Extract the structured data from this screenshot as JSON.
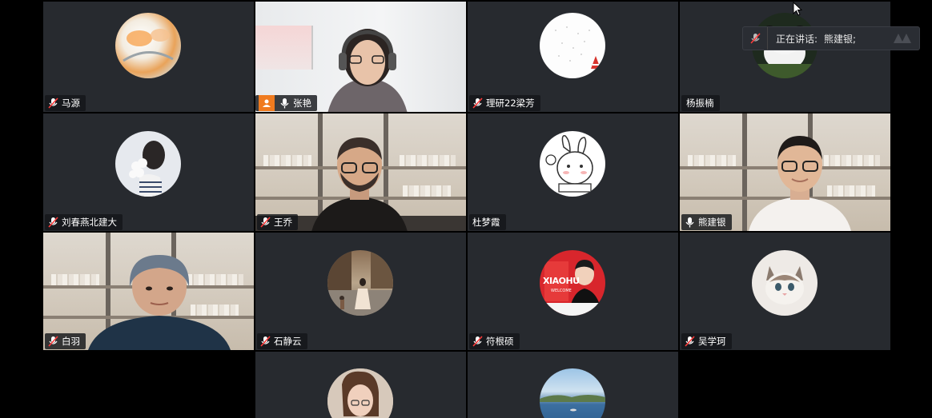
{
  "speaking_popup": {
    "label": "正在讲话:",
    "name": "熊建银;"
  },
  "participants": [
    {
      "name": "马源",
      "mic": "muted",
      "view": "avatar"
    },
    {
      "name": "张艳",
      "mic": "on",
      "view": "video",
      "host_badge": true
    },
    {
      "name": "理研22梁芳",
      "mic": "muted",
      "view": "avatar"
    },
    {
      "name": "杨振楠",
      "mic": "none",
      "view": "avatar"
    },
    {
      "name": "刘春燕北建大",
      "mic": "muted",
      "view": "avatar"
    },
    {
      "name": "王乔",
      "mic": "muted",
      "view": "video"
    },
    {
      "name": "杜梦霞",
      "mic": "none",
      "view": "avatar"
    },
    {
      "name": "熊建银",
      "mic": "on",
      "view": "video",
      "speaking": true
    },
    {
      "name": "白羽",
      "mic": "muted",
      "view": "video"
    },
    {
      "name": "石静云",
      "mic": "muted",
      "view": "avatar"
    },
    {
      "name": "符根硕",
      "mic": "muted",
      "view": "avatar"
    },
    {
      "name": "吴学珂",
      "mic": "muted",
      "view": "avatar"
    },
    {
      "name": "",
      "mic": "none",
      "view": "avatar"
    },
    {
      "name": "",
      "mic": "none",
      "view": "avatar"
    }
  ],
  "avatar_text": {
    "xiaohu": "XIAOHU",
    "welcome": "WELCOME"
  },
  "colors": {
    "speaking_border": "#2fbf5f",
    "host_badge": "#f07b1f",
    "tile_bg": "#272a2f"
  }
}
